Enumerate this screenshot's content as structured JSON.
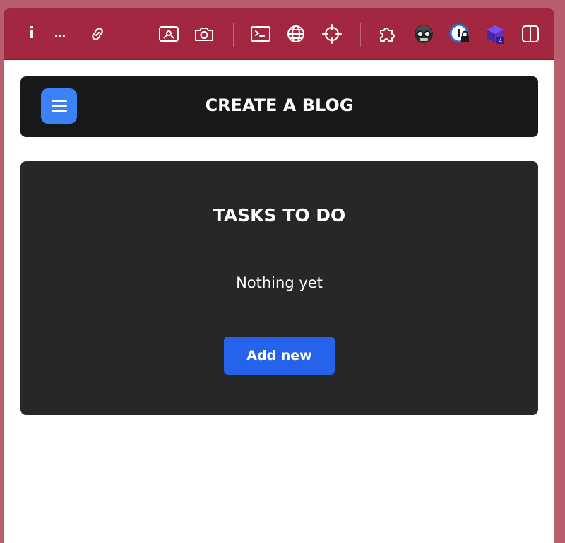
{
  "browser_toolbar": {
    "info_glyph": "i",
    "more_glyph": "…",
    "extensions": [
      {
        "name": "link-icon"
      },
      {
        "name": "screenshot-icon"
      },
      {
        "name": "camera-icon"
      },
      {
        "name": "terminal-icon"
      },
      {
        "name": "globe-icon"
      },
      {
        "name": "crosshair-icon"
      },
      {
        "name": "puzzle-icon"
      },
      {
        "name": "hacker-avatar-icon"
      },
      {
        "name": "password-lock-icon"
      },
      {
        "name": "stacked-cube-icon"
      },
      {
        "name": "sidebar-toggle-icon"
      }
    ],
    "cube_badge": "4",
    "colors": {
      "bar": "#a3283f",
      "icon": "#ffffff"
    }
  },
  "header": {
    "title": "CREATE A BLOG",
    "menu_icon": "hamburger-menu-icon",
    "colors": {
      "background": "#18181b",
      "menu_button": "#3b82f6"
    }
  },
  "tasks": {
    "title": "TASKS TO DO",
    "empty_message": "Nothing yet",
    "add_button_label": "Add new",
    "colors": {
      "card": "#27272a",
      "button": "#2563eb",
      "text": "#ffffff"
    }
  }
}
